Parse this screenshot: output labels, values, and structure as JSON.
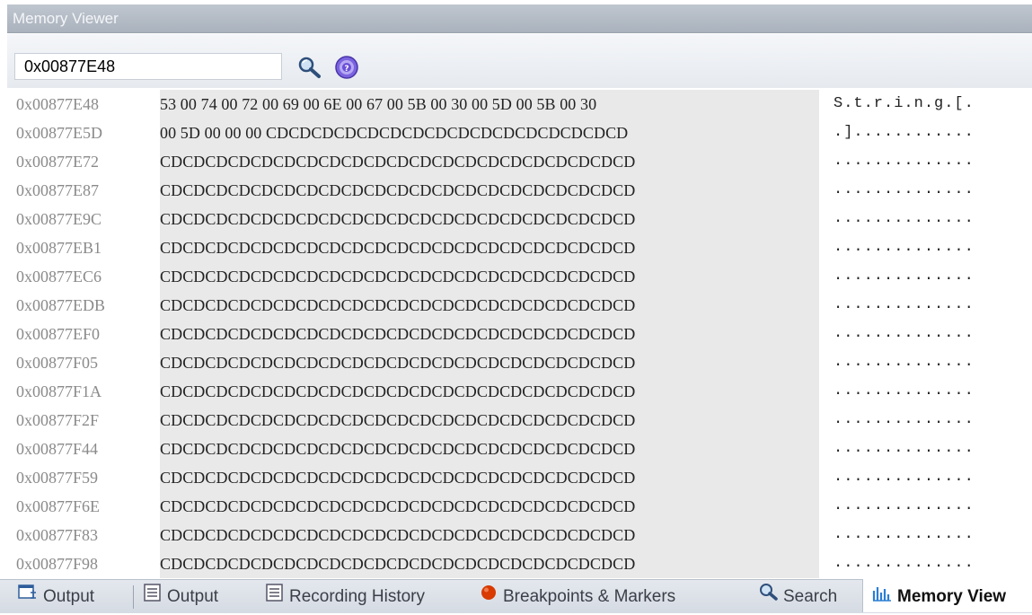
{
  "panel": {
    "title": "Memory Viewer"
  },
  "toolbar": {
    "address_value": "0x00877E48",
    "go_icon": "magnifier-icon",
    "help_icon": "help-icon"
  },
  "rows": [
    {
      "addr": "0x00877E48",
      "hex": "53 00 74 00 72 00 69 00 6E 00 67 00 5B 00 30 00 5D 00 5B 00 30",
      "ascii": "S.t.r.i.n.g.[."
    },
    {
      "addr": "0x00877E5D",
      "hex": "00 5D 00 00 00 CDCDCDCDCDCDCDCDCDCDCDCDCDCDCDCD",
      "ascii": ".]............"
    },
    {
      "addr": "0x00877E72",
      "hex": "CDCDCDCDCDCDCDCDCDCDCDCDCDCDCDCDCDCDCDCDCD",
      "ascii": ".............."
    },
    {
      "addr": "0x00877E87",
      "hex": "CDCDCDCDCDCDCDCDCDCDCDCDCDCDCDCDCDCDCDCDCD",
      "ascii": ".............."
    },
    {
      "addr": "0x00877E9C",
      "hex": "CDCDCDCDCDCDCDCDCDCDCDCDCDCDCDCDCDCDCDCDCD",
      "ascii": ".............."
    },
    {
      "addr": "0x00877EB1",
      "hex": "CDCDCDCDCDCDCDCDCDCDCDCDCDCDCDCDCDCDCDCDCD",
      "ascii": ".............."
    },
    {
      "addr": "0x00877EC6",
      "hex": "CDCDCDCDCDCDCDCDCDCDCDCDCDCDCDCDCDCDCDCDCD",
      "ascii": ".............."
    },
    {
      "addr": "0x00877EDB",
      "hex": "CDCDCDCDCDCDCDCDCDCDCDCDCDCDCDCDCDCDCDCDCD",
      "ascii": ".............."
    },
    {
      "addr": "0x00877EF0",
      "hex": "CDCDCDCDCDCDCDCDCDCDCDCDCDCDCDCDCDCDCDCDCD",
      "ascii": ".............."
    },
    {
      "addr": "0x00877F05",
      "hex": "CDCDCDCDCDCDCDCDCDCDCDCDCDCDCDCDCDCDCDCDCD",
      "ascii": ".............."
    },
    {
      "addr": "0x00877F1A",
      "hex": "CDCDCDCDCDCDCDCDCDCDCDCDCDCDCDCDCDCDCDCDCD",
      "ascii": ".............."
    },
    {
      "addr": "0x00877F2F",
      "hex": "CDCDCDCDCDCDCDCDCDCDCDCDCDCDCDCDCDCDCDCDCD",
      "ascii": ".............."
    },
    {
      "addr": "0x00877F44",
      "hex": "CDCDCDCDCDCDCDCDCDCDCDCDCDCDCDCDCDCDCDCDCD",
      "ascii": ".............."
    },
    {
      "addr": "0x00877F59",
      "hex": "CDCDCDCDCDCDCDCDCDCDCDCDCDCDCDCDCDCDCDCDCD",
      "ascii": ".............."
    },
    {
      "addr": "0x00877F6E",
      "hex": "CDCDCDCDCDCDCDCDCDCDCDCDCDCDCDCDCDCDCDCDCD",
      "ascii": ".............."
    },
    {
      "addr": "0x00877F83",
      "hex": "CDCDCDCDCDCDCDCDCDCDCDCDCDCDCDCDCDCDCDCDCD",
      "ascii": ".............."
    },
    {
      "addr": "0x00877F98",
      "hex": "CDCDCDCDCDCDCDCDCDCDCDCDCDCDCDCDCDCDCDCDCD",
      "ascii": ".............."
    }
  ],
  "tabs": [
    {
      "label": "Output",
      "icon": "output-build-icon"
    },
    {
      "label": "Output",
      "icon": "output-list-icon"
    },
    {
      "label": "Recording History",
      "icon": "recording-history-icon"
    },
    {
      "label": "Breakpoints & Markers",
      "icon": "breakpoint-icon"
    },
    {
      "label": "Search",
      "icon": "search-icon"
    },
    {
      "label": "Memory View",
      "icon": "memory-view-icon",
      "active": true
    }
  ],
  "colors": {
    "title_bar": "#aab2bd",
    "hex_background": "#e9e9e9",
    "address_text": "#8a8a8a",
    "breakpoint": "#d83a00",
    "help_icon": "#6a4fd8"
  }
}
